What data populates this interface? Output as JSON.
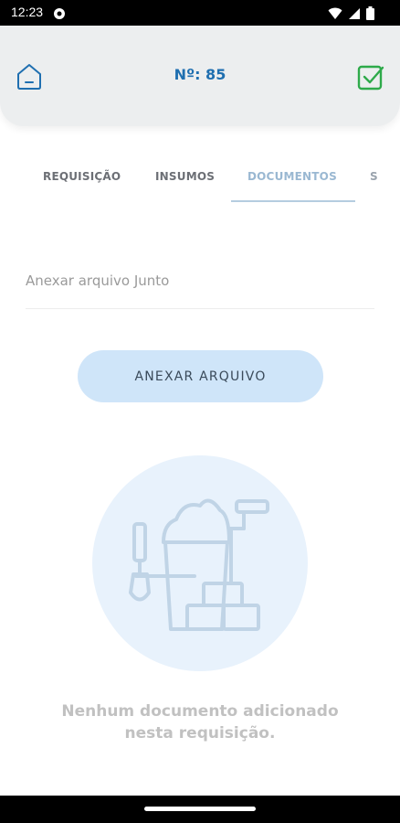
{
  "status_bar": {
    "time": "12:23",
    "icons": [
      "notification-icon",
      "wifi-icon",
      "signal-icon",
      "battery-icon"
    ]
  },
  "header": {
    "title": "Nº: 85",
    "left_icon": "home-icon",
    "right_icon": "checkbox-check-icon",
    "accent_color": "#1f6fb0",
    "check_color": "#2eaa4a"
  },
  "tabs": [
    {
      "label": "REQUISIÇÃO",
      "active": false
    },
    {
      "label": "INSUMOS",
      "active": false
    },
    {
      "label": "DOCUMENTOS",
      "active": true
    },
    {
      "label": "S",
      "active": false
    }
  ],
  "attachment_field": {
    "placeholder": "Anexar arquivo Junto",
    "value": ""
  },
  "attach_button": {
    "label": "ANEXAR ARQUIVO",
    "color": "#cfe5f9"
  },
  "empty_state": {
    "illustration": "construction-materials-icon",
    "message_line1": "Nenhum documento adicionado",
    "message_line2": "nesta requisição."
  }
}
